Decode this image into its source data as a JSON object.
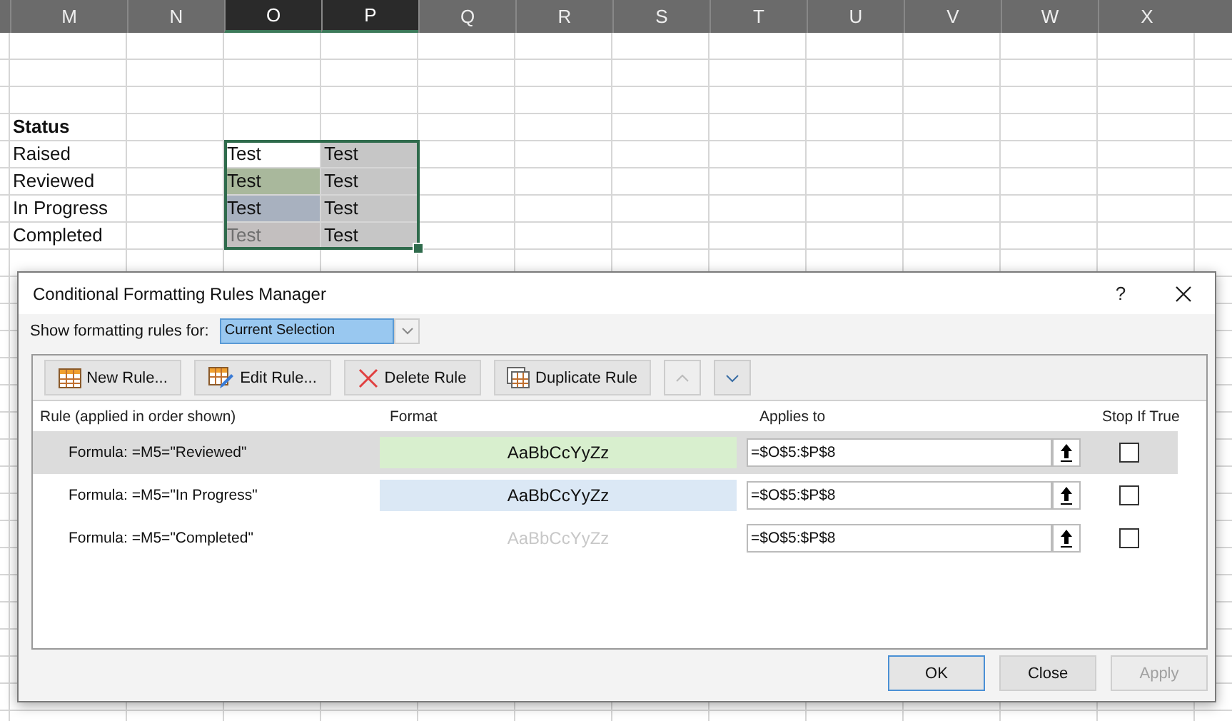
{
  "sheet": {
    "columns": [
      {
        "label": "M",
        "selected": false
      },
      {
        "label": "N",
        "selected": false
      },
      {
        "label": "O",
        "selected": true
      },
      {
        "label": "P",
        "selected": true
      },
      {
        "label": "Q",
        "selected": false
      },
      {
        "label": "R",
        "selected": false
      },
      {
        "label": "S",
        "selected": false
      },
      {
        "label": "T",
        "selected": false
      },
      {
        "label": "U",
        "selected": false
      },
      {
        "label": "V",
        "selected": false
      },
      {
        "label": "W",
        "selected": false
      },
      {
        "label": "X",
        "selected": false
      }
    ],
    "status_header": "Status",
    "rows": [
      {
        "label": "Raised",
        "cells": [
          {
            "text": "Test",
            "color": "#ffffff",
            "dimmed": false
          },
          {
            "text": "Test",
            "color": "#c6c6c6",
            "dimmed": false
          }
        ]
      },
      {
        "label": "Reviewed",
        "cells": [
          {
            "text": "Test",
            "color": "#a9b89c",
            "dimmed": false
          },
          {
            "text": "Test",
            "color": "#c6c6c6",
            "dimmed": false
          }
        ]
      },
      {
        "label": "In Progress",
        "cells": [
          {
            "text": "Test",
            "color": "#a8b1bf",
            "dimmed": false
          },
          {
            "text": "Test",
            "color": "#c6c6c6",
            "dimmed": false
          }
        ]
      },
      {
        "label": "Completed",
        "cells": [
          {
            "text": "Test",
            "color": "#c3bfbf",
            "dimmed": true
          },
          {
            "text": "Test",
            "color": "#c6c6c6",
            "dimmed": false
          }
        ]
      }
    ]
  },
  "dialog": {
    "title": "Conditional Formatting Rules Manager",
    "help": "?",
    "show_label": "Show formatting rules for:",
    "show_value": "Current Selection",
    "toolbar": [
      {
        "label": "New Rule...",
        "kind": "new"
      },
      {
        "label": "Edit Rule...",
        "kind": "edit"
      },
      {
        "label": "Delete Rule",
        "kind": "delete"
      },
      {
        "label": "Duplicate Rule",
        "kind": "duplicate"
      }
    ],
    "arrows": [
      {
        "kind": "up",
        "disabled": true
      },
      {
        "kind": "down",
        "disabled": false
      }
    ],
    "columns": [
      "Rule (applied in order shown)",
      "Format",
      "Applies to",
      "Stop If True"
    ],
    "rules": [
      {
        "formula": "Formula: =M5=\"Reviewed\"",
        "preview": "AaBbCcYyZz",
        "color": "#d8efce",
        "dimmed": false,
        "applies_to": "=$O$5:$P$8",
        "stop_if_true": false,
        "selected": true
      },
      {
        "formula": "Formula: =M5=\"In Progress\"",
        "preview": "AaBbCcYyZz",
        "color": "#dbe8f5",
        "dimmed": false,
        "applies_to": "=$O$5:$P$8",
        "stop_if_true": false,
        "selected": false
      },
      {
        "formula": "Formula: =M5=\"Completed\"",
        "preview": "AaBbCcYyZz",
        "color": "#ffffff",
        "dimmed": true,
        "applies_to": "=$O$5:$P$8",
        "stop_if_true": false,
        "selected": false
      }
    ],
    "buttons": [
      {
        "label": "OK",
        "default": true,
        "disabled": false
      },
      {
        "label": "Close",
        "default": false,
        "disabled": false
      },
      {
        "label": "Apply",
        "default": false,
        "disabled": true
      }
    ]
  }
}
